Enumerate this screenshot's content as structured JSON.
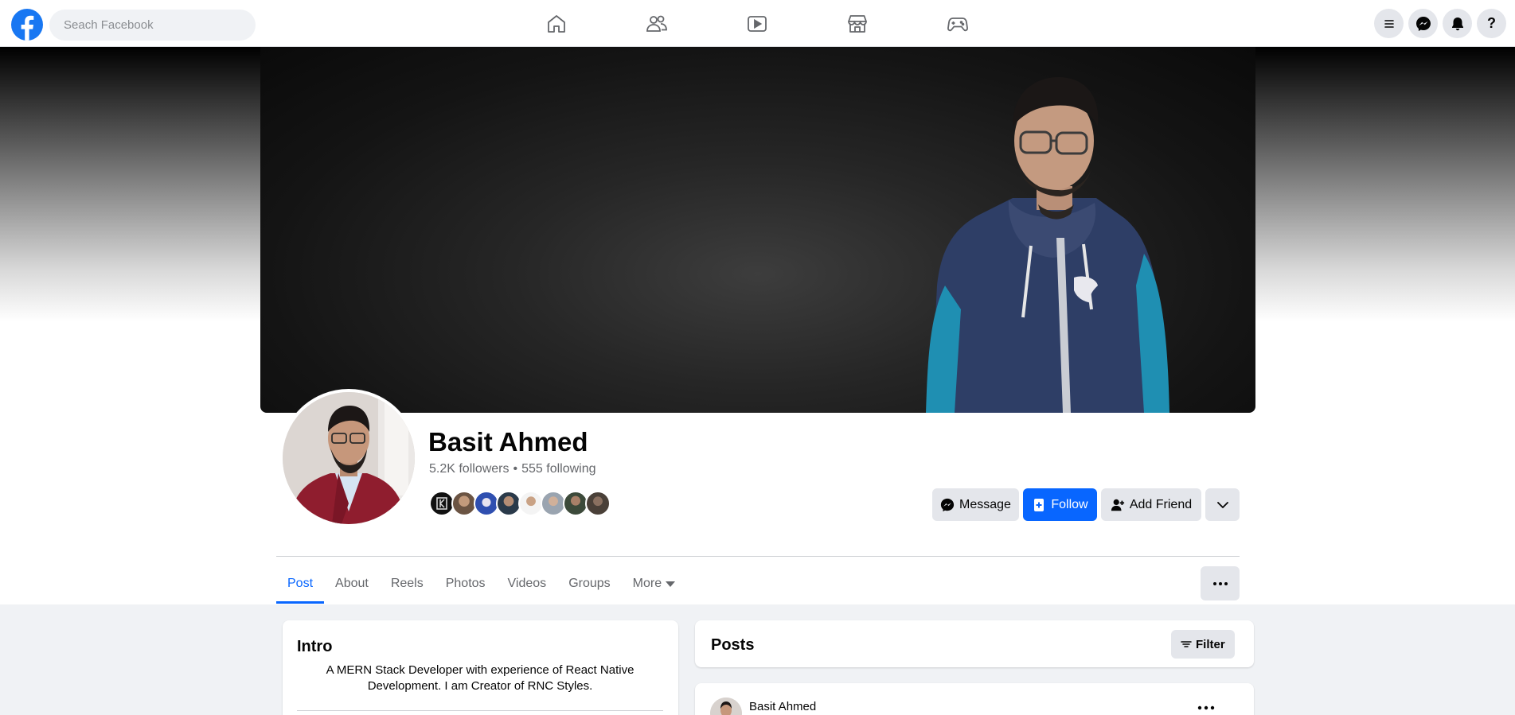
{
  "search": {
    "placeholder": "Seach Facebook"
  },
  "nav": {
    "center_icons": [
      "home-icon",
      "friends-icon",
      "watch-icon",
      "marketplace-icon",
      "gaming-icon"
    ],
    "right_icons": [
      "menu-icon",
      "messenger-icon",
      "notifications-icon",
      "help-icon"
    ],
    "help_glyph": "?"
  },
  "profile": {
    "name": "Basit Ahmed",
    "followers": "5.2K followers",
    "separator": "•",
    "following": "555 following"
  },
  "actions": {
    "message_label": "Message",
    "follow_label": "Follow",
    "add_friend_label": "Add Friend"
  },
  "tabs": {
    "items": [
      "Post",
      "About",
      "Reels",
      "Photos",
      "Videos",
      "Groups",
      "More"
    ],
    "active": "Post"
  },
  "intro": {
    "title": "Intro",
    "bio": "A MERN Stack Developer with experience of React Native Development. I am Creator of RNC Styles."
  },
  "posts": {
    "title": "Posts",
    "filter_label": "Filter",
    "first_post_author": "Basit Ahmed"
  },
  "colors": {
    "brand": "#1877f2",
    "follow_button": "#0866ff",
    "active_tab": "#0866ff",
    "secondary_text": "#65676b",
    "button_grey": "#e4e6eb",
    "page_background": "#f0f2f5"
  }
}
